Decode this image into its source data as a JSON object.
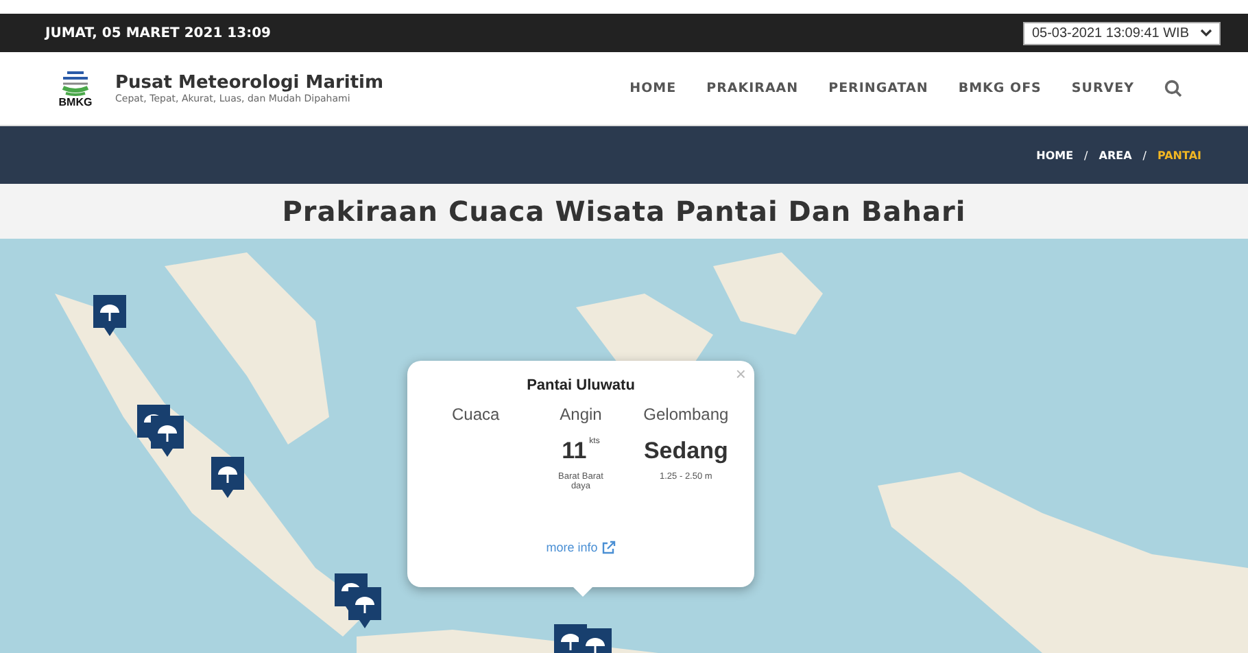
{
  "top_bar": {
    "date": "JUMAT, 05 MARET 2021 13:09",
    "time_select": "05-03-2021 13:09:41 WIB"
  },
  "header": {
    "logo_text": "BMKG",
    "org_name": "Pusat Meteorologi Maritim",
    "tagline": "Cepat, Tepat, Akurat, Luas, dan Mudah Dipahami",
    "nav": [
      "HOME",
      "PRAKIRAAN",
      "PERINGATAN",
      "BMKG OFS",
      "SURVEY"
    ]
  },
  "breadcrumb_separator": "/",
  "breadcrumb": [
    {
      "label": "HOME",
      "selected": false
    },
    {
      "label": "AREA",
      "selected": false
    },
    {
      "label": "PANTAI",
      "selected": true
    }
  ],
  "page_title": "Prakiraan Cuaca Wisata Pantai Dan Bahari",
  "popup": {
    "title": "Pantai Uluwatu",
    "close": "×",
    "columns": [
      {
        "heading": "Cuaca"
      },
      {
        "heading": "Angin",
        "value": "11",
        "unit": "kts",
        "detail": "Barat Barat daya"
      },
      {
        "heading": "Gelombang",
        "value": "Sedang",
        "detail": "1.25 - 2.50 m"
      }
    ],
    "link": "more info"
  }
}
